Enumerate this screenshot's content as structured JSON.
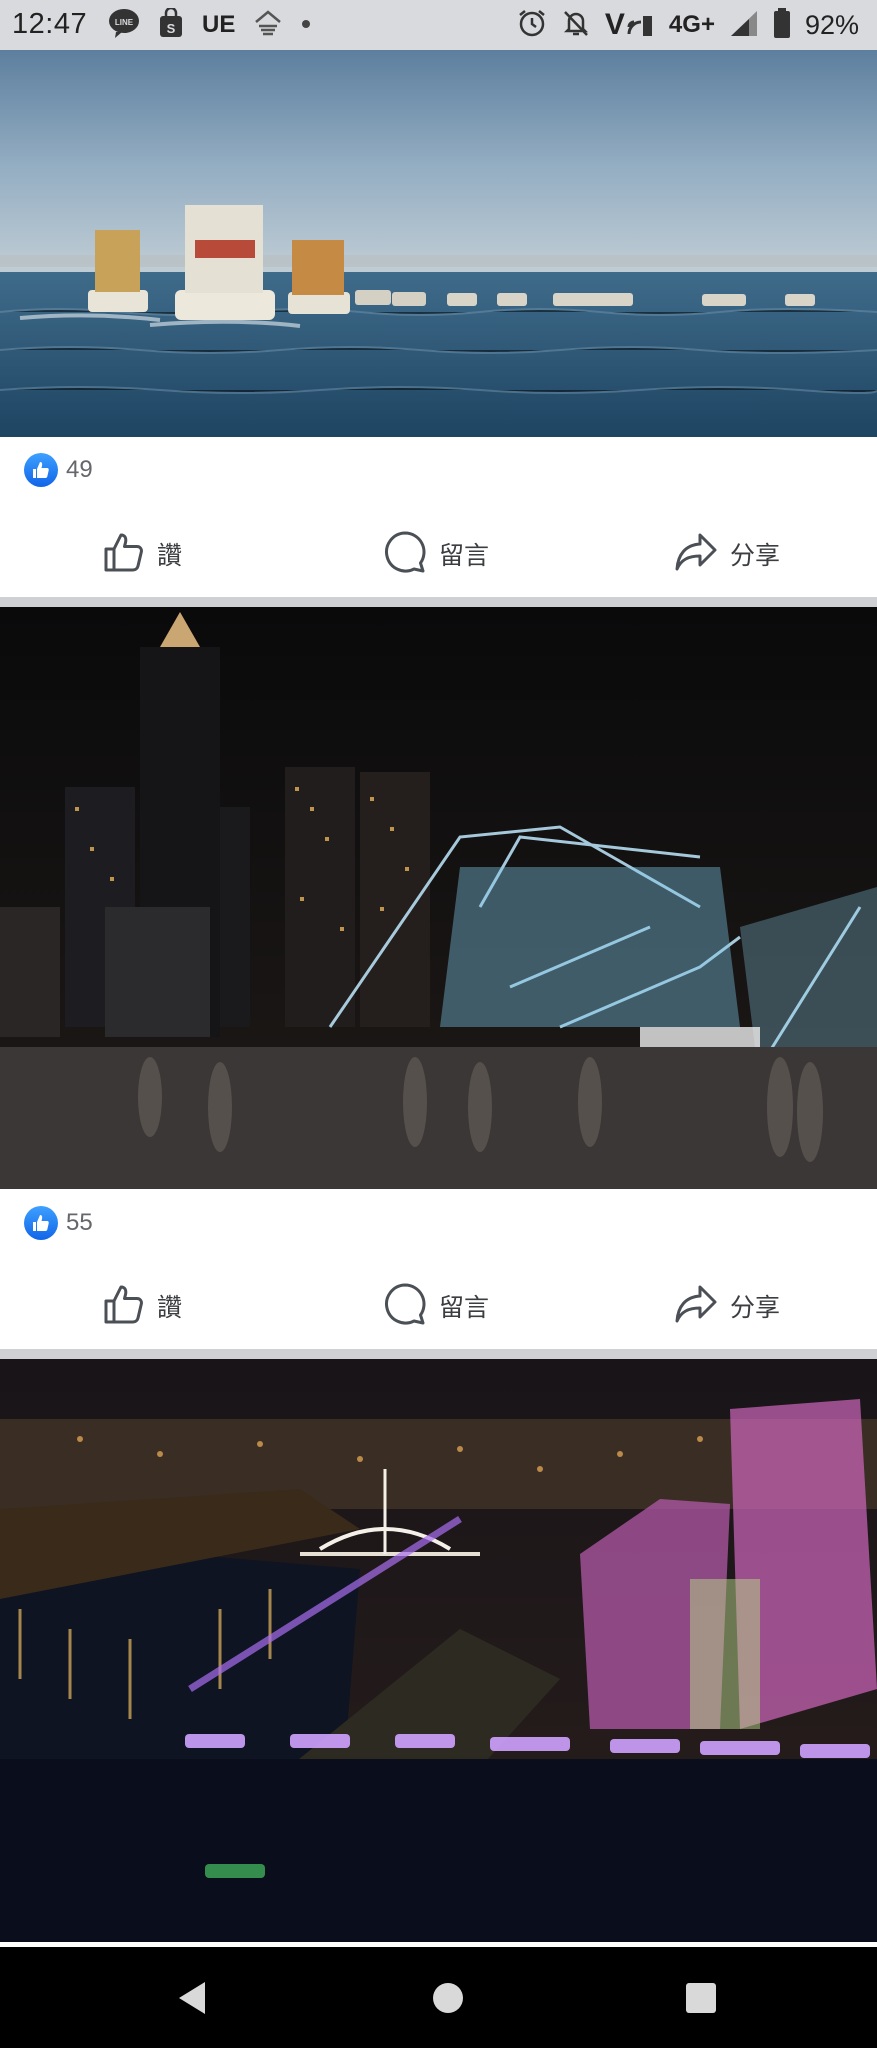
{
  "status_bar": {
    "time": "12:47",
    "app_icons": [
      "line-icon",
      "shopping-bag-icon",
      "ue-icon",
      "weather-icon",
      "dot-icon"
    ],
    "ue_label": "UE",
    "network_label": "4G+",
    "volte_label": "V",
    "battery_percent": "92%"
  },
  "posts": [
    {
      "image": "fishing-boats-at-sea-photo",
      "like_count": "49"
    },
    {
      "image": "lit-boats-night-harbor-photo",
      "like_count": "55"
    },
    {
      "image": "aerial-night-harbor-photo"
    }
  ],
  "actions": {
    "like": "讚",
    "comment": "留言",
    "share": "分享"
  },
  "nav": {
    "icons": [
      "back-icon",
      "home-icon",
      "recent-apps-icon"
    ]
  },
  "colors": {
    "like_blue": "#1877f2",
    "divider": "#ced0d4",
    "status_bar_bg": "#d8dadd"
  }
}
